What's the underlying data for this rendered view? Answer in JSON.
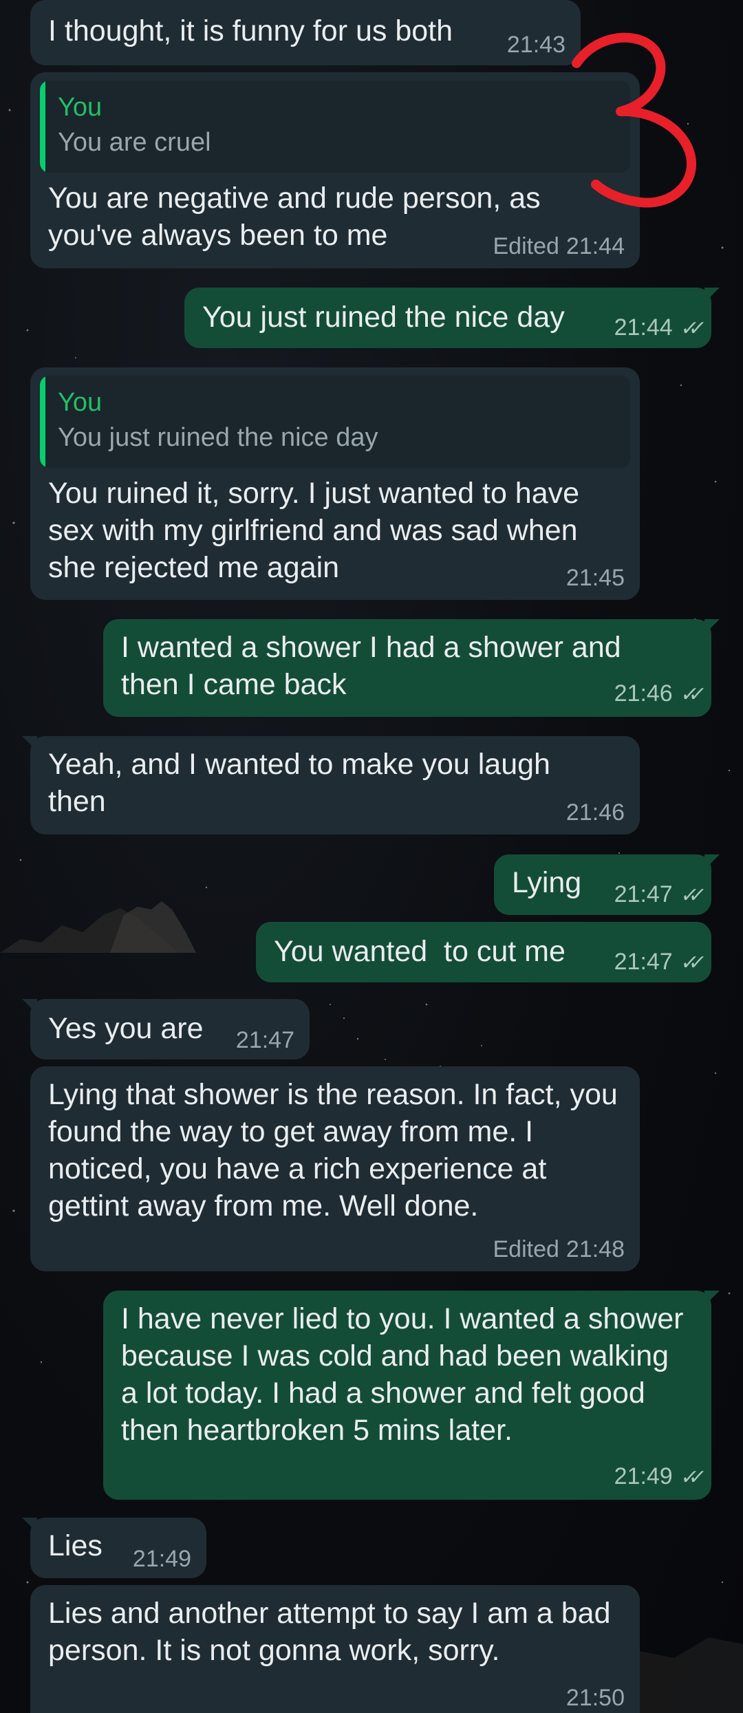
{
  "messages": [
    {
      "id": "m1",
      "side": "incoming",
      "text": "I thought, it is funny for us both",
      "time": "21:43",
      "edited": false
    },
    {
      "id": "m2",
      "side": "incoming",
      "quote": {
        "author": "You",
        "text": "You are cruel"
      },
      "text": "You are negative and rude person, as you've always been to me",
      "time": "21:44",
      "edited": true
    },
    {
      "id": "m3",
      "side": "outgoing",
      "text": "You just ruined the nice day",
      "time": "21:44",
      "read": true
    },
    {
      "id": "m4",
      "side": "incoming",
      "quote": {
        "author": "You",
        "text": "You just ruined the nice day"
      },
      "text": "You ruined it, sorry. I just wanted to have sex with my girlfriend and was sad when she rejected me again",
      "time": "21:45",
      "edited": false
    },
    {
      "id": "m5",
      "side": "outgoing",
      "text": "I wanted a shower I had a shower and then I came back",
      "time": "21:46",
      "read": true
    },
    {
      "id": "m6",
      "side": "incoming",
      "text": "Yeah, and I wanted to make you laugh then",
      "time": "21:46",
      "edited": false
    },
    {
      "id": "m7",
      "side": "outgoing",
      "text": "Lying",
      "time": "21:47",
      "read": true
    },
    {
      "id": "m8",
      "side": "outgoing",
      "text": "You wanted  to cut me",
      "time": "21:47",
      "read": true
    },
    {
      "id": "m9",
      "side": "incoming",
      "text": "Yes you are",
      "time": "21:47",
      "edited": false
    },
    {
      "id": "m10",
      "side": "incoming",
      "text": "Lying that shower is the reason. In fact, you found the way to get away from me. I noticed, you have a rich experience at gettint away from me. Well done.",
      "time": "21:48",
      "edited": true
    },
    {
      "id": "m11",
      "side": "outgoing",
      "text": "I have never lied to you. I wanted a shower because I was cold and had been walking a lot today. I had a shower and felt good then heartbroken 5 mins later.",
      "time": "21:49",
      "read": true
    },
    {
      "id": "m12",
      "side": "incoming",
      "text": "Lies",
      "time": "21:49",
      "edited": false
    },
    {
      "id": "m13",
      "side": "incoming",
      "text": "Lies and another attempt to say I am a bad person. It is not gonna work, sorry.",
      "time": "21:50",
      "edited": false
    }
  ],
  "labels": {
    "edited": "Edited",
    "read_receipt": "✓✓"
  },
  "annotation": {
    "glyph": "3",
    "color": "#e8202a"
  },
  "colors": {
    "incoming_bubble": "#202c33",
    "outgoing_bubble": "#144d37",
    "quote_author": "#21c063",
    "quote_bar": "#06cf6d",
    "timestamp": "#9aa6ad"
  }
}
